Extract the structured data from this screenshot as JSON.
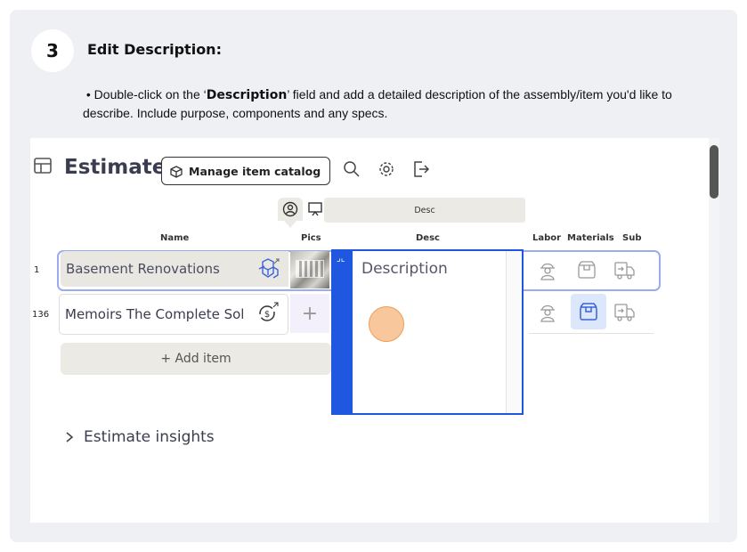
{
  "step": {
    "number": "3",
    "title": "Edit Description:",
    "instruction_pre": "• Double-click on the ‘",
    "instruction_bold": "Description",
    "instruction_post": "’ field and add a detailed description of the assembly/item you'd like to describe. Include purpose, components and any specs."
  },
  "header": {
    "title": "Estimate",
    "manage_catalog_label": "Manage item catalog"
  },
  "view_band": {
    "label": "Desc"
  },
  "columns": {
    "name": "Name",
    "pics": "Pics",
    "desc": "Desc",
    "labor": "Labor",
    "materials": "Materials",
    "sub": "Sub"
  },
  "rows": [
    {
      "num": "1",
      "name": "Basement Renovations"
    },
    {
      "num": "136",
      "name": "Memoirs The Complete Sol"
    }
  ],
  "description_editor": {
    "placeholder": "Description"
  },
  "add_item_label": "+ Add item",
  "insights_label": "Estimate insights",
  "colors": {
    "accent_blue": "#1f57e0",
    "row_outline": "#9aabf0",
    "cursor_fill": "#f8c79b",
    "band_beige": "#eceae4"
  },
  "icons": [
    "table-icon",
    "catalog-box-icon",
    "search-icon",
    "gear-icon",
    "export-icon",
    "person-icon",
    "presentation-icon",
    "cubes-icon",
    "dollar-cycle-icon",
    "worker-icon",
    "box-icon",
    "truck-icon",
    "chevron-right-icon",
    "collapse-icon"
  ]
}
